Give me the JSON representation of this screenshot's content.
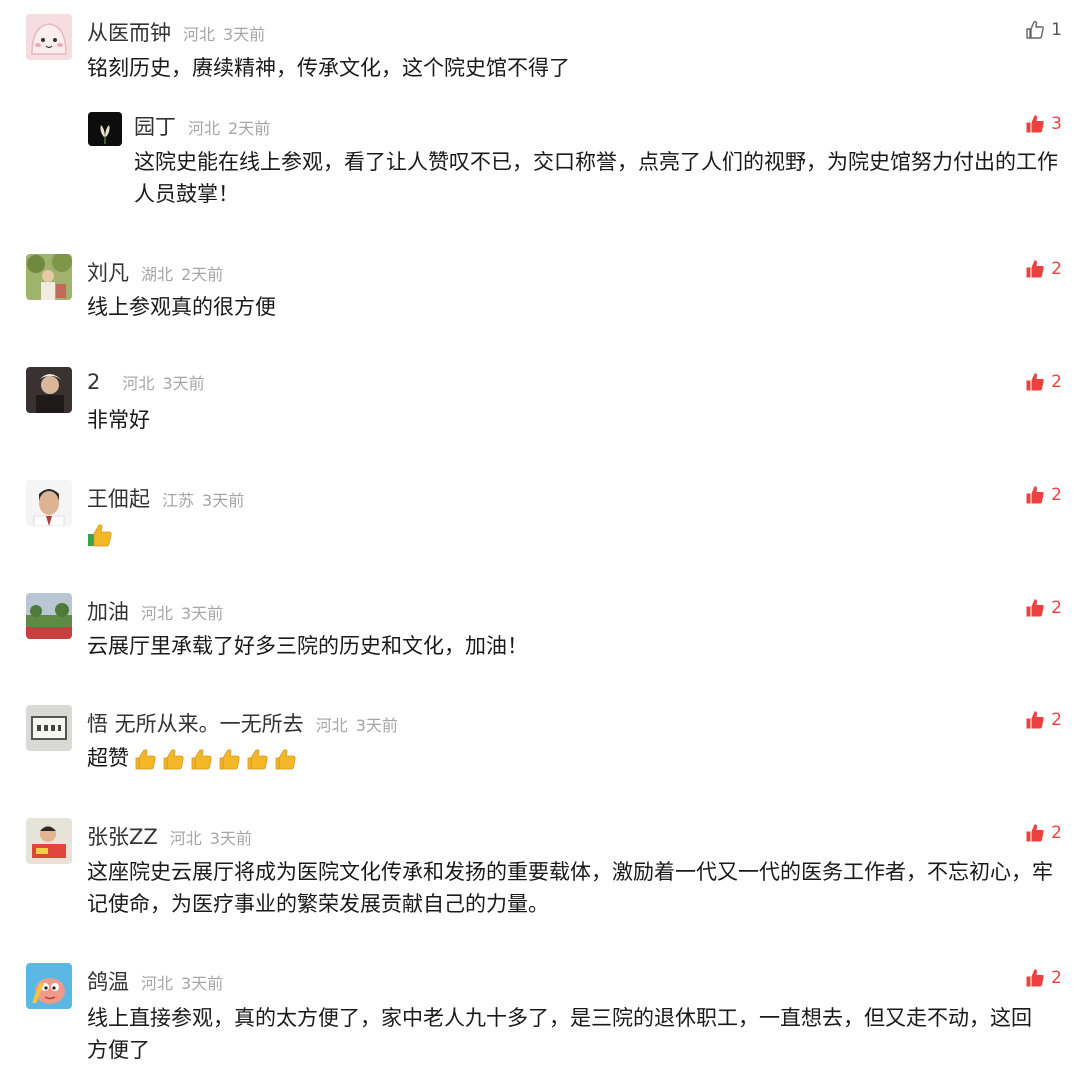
{
  "colors": {
    "liked": "#ec4141",
    "meta": "#a6a6a6",
    "text": "#1a1a1a"
  },
  "comments": [
    {
      "name": "从医而钟",
      "location": "河北",
      "time": "3天前",
      "likes": "1",
      "liked": false,
      "text": "铭刻历史，赓续精神，传承文化，这个院史馆不得了"
    },
    {
      "name": "园丁",
      "location": "河北",
      "time": "2天前",
      "likes": "3",
      "liked": true,
      "reply": true,
      "text": "这院史能在线上参观，看了让人赞叹不已，交口称誉，点亮了人们的视野，为院史馆努力付出的工作人员鼓掌！"
    },
    {
      "name": "刘凡",
      "location": "湖北",
      "time": "2天前",
      "likes": "2",
      "liked": true,
      "text": "线上参观真的很方便"
    },
    {
      "name": "2",
      "location": "河北",
      "time": "3天前",
      "likes": "2",
      "liked": true,
      "text": "非常好"
    },
    {
      "name": "王佃起",
      "location": "江苏",
      "time": "3天前",
      "likes": "2",
      "liked": true,
      "text": "",
      "emoji_count": 1,
      "emoji": "thumbs-up-emoji"
    },
    {
      "name": "加油",
      "location": "河北",
      "time": "3天前",
      "likes": "2",
      "liked": true,
      "text": "云展厅里承载了好多三院的历史和文化，加油！"
    },
    {
      "name": "悟  无所从来。一无所去",
      "location": "河北",
      "time": "3天前",
      "likes": "2",
      "liked": true,
      "text": "超赞",
      "emoji_count": 6,
      "emoji": "thumbs-up-emoji"
    },
    {
      "name": "张张ZZ",
      "location": "河北",
      "time": "3天前",
      "likes": "2",
      "liked": true,
      "text": "这座院史云展厅将成为医院文化传承和发扬的重要载体，激励着一代又一代的医务工作者，不忘初心，牢记使命，为医疗事业的繁荣发展贡献自己的力量。"
    },
    {
      "name": "鸽温",
      "location": "河北",
      "time": "3天前",
      "likes": "2",
      "liked": true,
      "text": "线上直接参观，真的太方便了，家中老人九十多了，是三院的退休职工，一直想去，但又走不动，这回方便了"
    }
  ]
}
